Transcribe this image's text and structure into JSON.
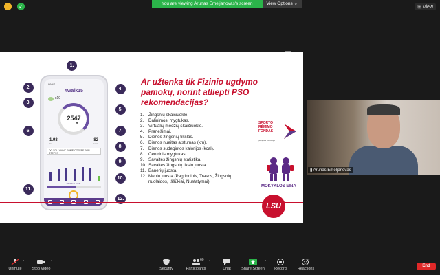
{
  "topbar": {
    "banner_message": "You are viewing Arunas Emeljanovas's screen",
    "view_options_label": "View Options ⌄",
    "view_label": "View"
  },
  "phone": {
    "time": "09:47",
    "hashtag": "#walk15",
    "multiplier": "x10",
    "steps": "2547",
    "distance": "1.93",
    "distance_unit": "km",
    "kcal": "82",
    "kcal_unit": "kcal",
    "banner_text": "DO YOU WANT SOME COFFEE FOR STEPS?",
    "goal_label": "WEEKLY GOAL",
    "bar_levels": [
      0.55,
      0.7,
      0.8,
      0.72,
      0.85,
      0.78,
      0.3
    ]
  },
  "callouts": [
    "1.",
    "2.",
    "3.",
    "4.",
    "5.",
    "6.",
    "7.",
    "8.",
    "9.",
    "10.",
    "11.",
    "12."
  ],
  "slide": {
    "title": "Ar užtenka tik Fizinio ugdymo pamokų, norint atliepti PSO rekomendacijas?",
    "list": [
      {
        "num": "1.",
        "text": "Žingsnių skaičiuoklė."
      },
      {
        "num": "2.",
        "text": "Dalinimosi mygtukas."
      },
      {
        "num": "3.",
        "text": "Virtualių medžių skaičiuoklė."
      },
      {
        "num": "4.",
        "text": "Pranešimai."
      },
      {
        "num": "5.",
        "text": "Dienos žingsnių tikslas."
      },
      {
        "num": "6.",
        "text": "Dienos nueitas atstumas (km)."
      },
      {
        "num": "7.",
        "text": "Dienos sudegintos kalorijos (kcal)."
      },
      {
        "num": "8.",
        "text": "Centrinis mygtukas."
      },
      {
        "num": "9.",
        "text": "Savaitės žingsnių statistika."
      },
      {
        "num": "10.",
        "text": "Savaitės žingsnių tikslo juosta."
      },
      {
        "num": "11.",
        "text": "Banerių juosta."
      },
      {
        "num": "12.",
        "text": "Meniu juosta (Pagrindinis, Trasos, Žingsnių nuolaidos, Iššūkiai, Nustatymai)."
      }
    ],
    "srf_logo_text": "SPORTO RĖMIMO FONDAS",
    "srf_sub": "Įsteigtas Lietuvoje",
    "mokyklos_text": "MOKYKLOS EINA",
    "lsu_text": "LSU",
    "accent": "#c8102e",
    "purple": "#5b3b8b"
  },
  "video": {
    "participant_name": "Arunas Emeljanovas"
  },
  "toolbar": {
    "unmute": "Unmute",
    "stop_video": "Stop Video",
    "security": "Security",
    "participants": "Participants",
    "participants_count": "60",
    "chat": "Chat",
    "share_screen": "Share Screen",
    "record": "Record",
    "reactions": "Reactions",
    "end": "End"
  }
}
